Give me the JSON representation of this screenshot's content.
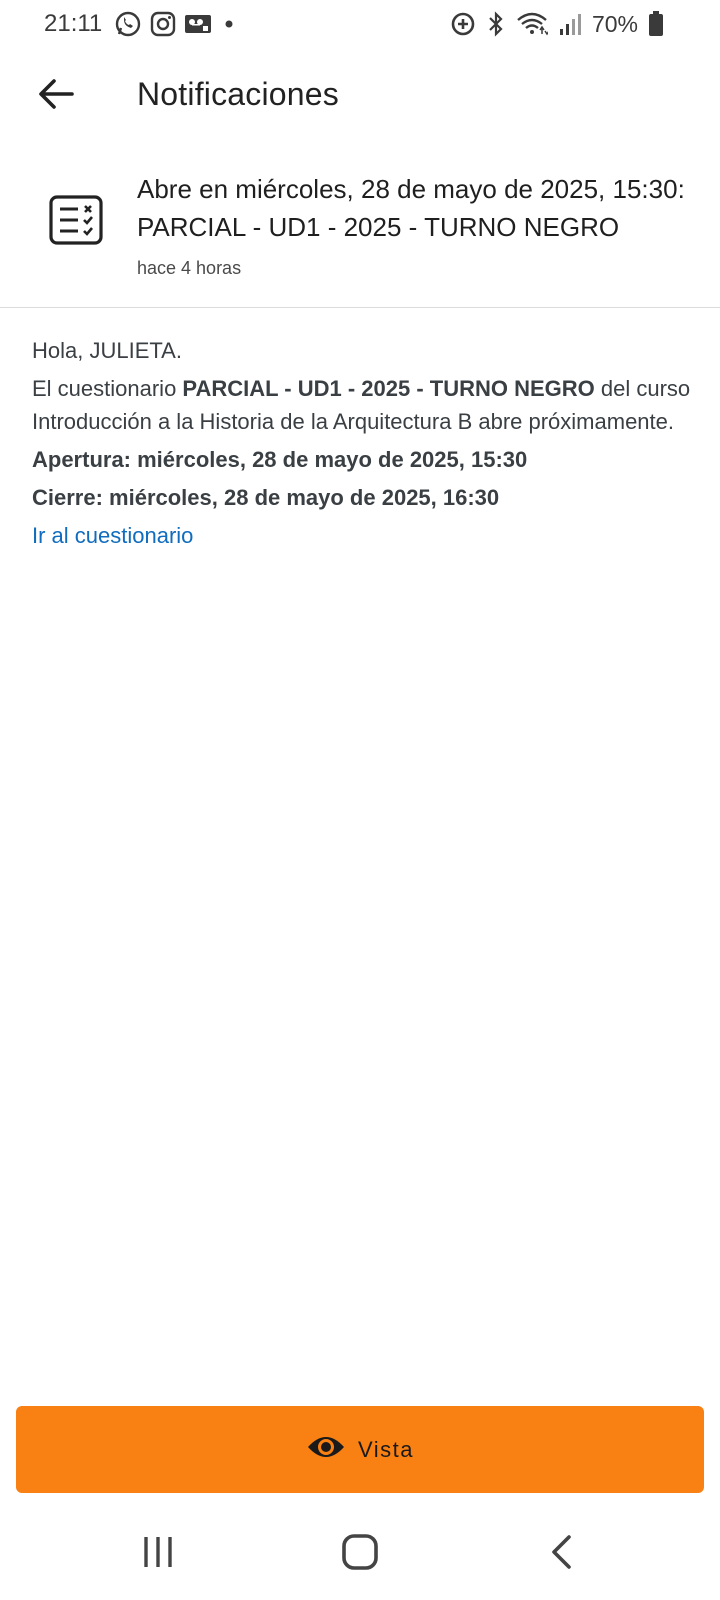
{
  "status_bar": {
    "time": "21:11",
    "battery": "70%",
    "left_icons": [
      "whatsapp-icon",
      "instagram-icon",
      "voicemail-icon",
      "dot-icon"
    ],
    "right_icons": [
      "data-saver-icon",
      "bluetooth-icon",
      "wifi-icon",
      "signal-icon",
      "battery-icon"
    ]
  },
  "app_bar": {
    "title": "Notificaciones",
    "back_icon": "arrow-left-icon"
  },
  "notification": {
    "icon": "quiz-icon",
    "title": "Abre en miércoles, 28 de mayo de 2025, 15:30: PARCIAL - UD1 - 2025 - TURNO NEGRO",
    "time_ago": "hace 4 horas"
  },
  "message": {
    "greeting": "Hola, JULIETA.",
    "intro_before": "El cuestionario ",
    "quiz_name": "PARCIAL - UD1 - 2025 - TURNO NEGRO",
    "intro_after": " del curso Introducción a la Historia de la Arquitectura B abre próximamente.",
    "opening": "Apertura: miércoles, 28 de mayo de 2025, 15:30",
    "closing": "Cierre: miércoles, 28 de mayo de 2025, 16:30",
    "link_label": "Ir al cuestionario"
  },
  "action": {
    "view_label": "Vista",
    "view_icon": "eye-icon",
    "color": "#f98012"
  },
  "nav_bar": {
    "icons": [
      "recents-icon",
      "home-icon",
      "back-icon"
    ]
  },
  "colors": {
    "accent": "#f98012",
    "link": "#0f6cbf"
  }
}
